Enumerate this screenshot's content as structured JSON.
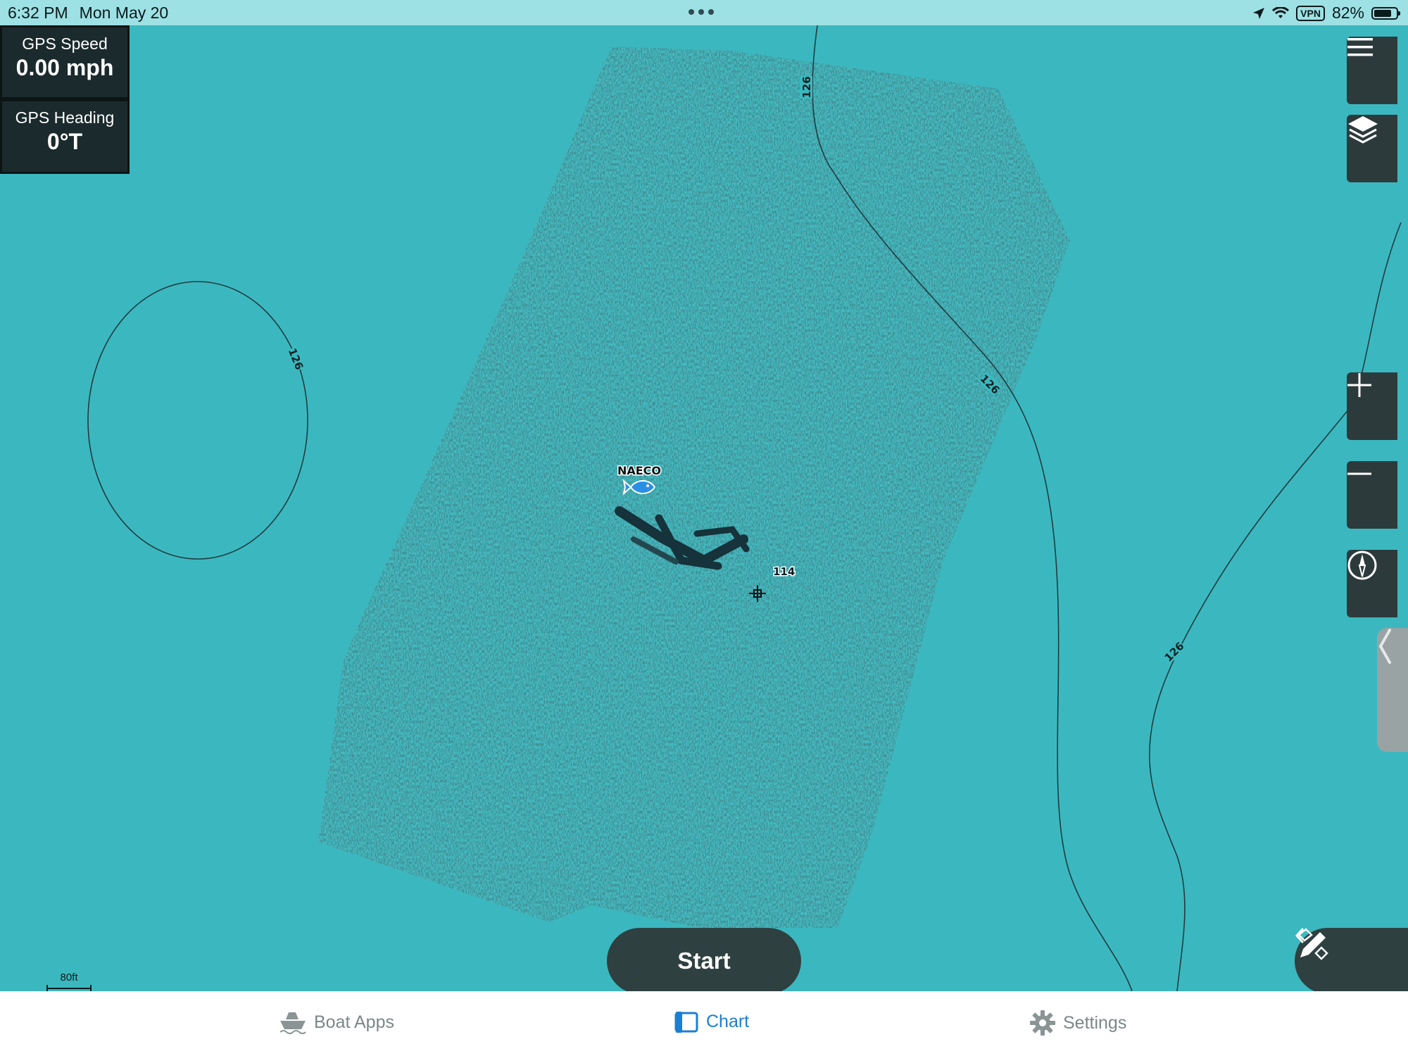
{
  "status_bar": {
    "time": "6:32 PM",
    "date": "Mon May 20",
    "vpn": "VPN",
    "battery": "82%",
    "battery_level": 0.82
  },
  "gps": {
    "speed_label": "GPS Speed",
    "speed_value": "0.00 mph",
    "heading_label": "GPS Heading",
    "heading_value": "0°T"
  },
  "map": {
    "waypoint_label": "NAECO",
    "depth_labels": {
      "contour_left": "126",
      "contour_top": "126",
      "contour_mid": "126",
      "contour_right": "126",
      "sounding": "114"
    },
    "scale_label": "80ft"
  },
  "controls": {
    "start_label": "Start",
    "menu_icon": "hamburger-menu-icon",
    "layers_icon": "layers-icon",
    "zoom_in_icon": "plus-icon",
    "zoom_out_icon": "minus-icon",
    "compass_icon": "compass-icon",
    "drawer_icon": "chevron-left-icon",
    "edit_icon": "pencil-ruler-icon"
  },
  "tabs": [
    {
      "label": "Boat Apps",
      "icon": "boat-icon",
      "active": false
    },
    {
      "label": "Chart",
      "icon": "chart-icon",
      "active": true
    },
    {
      "label": "Settings",
      "icon": "gear-icon",
      "active": false
    }
  ],
  "colors": {
    "water": "#3bb8bf",
    "status_bar": "#9ee1e4",
    "panel": "#2d3a3c",
    "active_tab": "#1b7fd2",
    "inactive_tab": "#7c8788"
  }
}
